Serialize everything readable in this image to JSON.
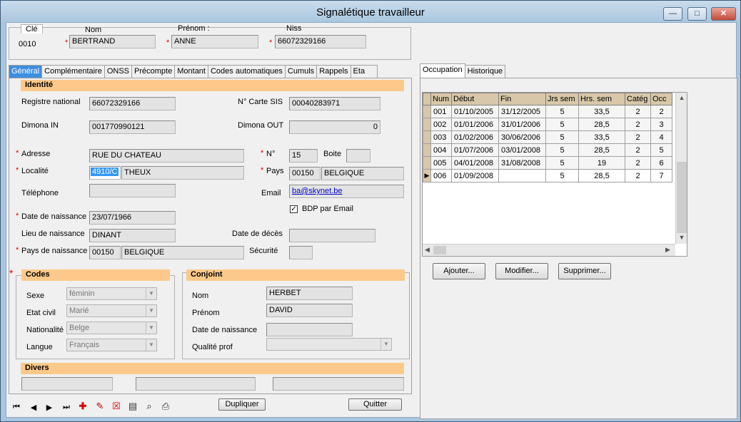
{
  "window": {
    "title": "Signalétique travailleur",
    "minimize": "—",
    "maximize": "□",
    "close": "✕"
  },
  "header": {
    "cle_label": "Clé",
    "cle_value": "0010",
    "nom_label": "Nom",
    "nom_value": "BERTRAND",
    "prenom_label": "Prénom :",
    "prenom_value": "ANNE",
    "niss_label": "Niss",
    "niss_value": "66072329166",
    "required_mark": "*"
  },
  "left_tabs": [
    "Général",
    "Complémentaire",
    "ONSS",
    "Précompte",
    "Montant",
    "Codes automatiques",
    "Cumuls",
    "Rappels",
    "Eta"
  ],
  "identite": {
    "title": "Identité",
    "registre_label": "Registre national",
    "registre_value": "66072329166",
    "carte_sis_label": "N° Carte SIS",
    "carte_sis_value": "00040283971",
    "dimona_in_label": "Dimona IN",
    "dimona_in_value": "001770990121",
    "dimona_out_label": "Dimona OUT",
    "dimona_out_value": "0",
    "adresse_label": "Adresse",
    "adresse_value": "RUE DU CHATEAU",
    "numero_label": "N°",
    "numero_value": "15",
    "boite_label": "Boite",
    "boite_value": "",
    "localite_label": "Localité",
    "localite_code": "4910/C",
    "localite_value": "THEUX",
    "pays_label": "Pays",
    "pays_code": "00150",
    "pays_value": "BELGIQUE",
    "telephone_label": "Téléphone",
    "telephone_value": "",
    "email_label": "Email",
    "email_value": "ba@skynet.be",
    "bdp_label": "BDP par Email",
    "bdp_checked": "✓",
    "naissance_label": "Date de naissance",
    "naissance_value": "23/07/1966",
    "lieu_label": "Lieu de naissance",
    "lieu_value": "DINANT",
    "deces_label": "Date de décès",
    "deces_value": "",
    "pays_naissance_label": "Pays de naissance",
    "pays_naissance_code": "00150",
    "pays_naissance_value": "BELGIQUE",
    "securite_label": "Sécurité",
    "securite_value": ""
  },
  "codes": {
    "title": "Codes",
    "sexe_label": "Sexe",
    "sexe_value": "féminin",
    "etat_civil_label": "Etat civil",
    "etat_civil_value": "Marié",
    "nationalite_label": "Nationalité",
    "nationalite_value": "Belge",
    "langue_label": "Langue",
    "langue_value": "Français"
  },
  "conjoint": {
    "title": "Conjoint",
    "nom_label": "Nom",
    "nom_value": "HERBET",
    "prenom_label": "Prénom",
    "prenom_value": "DAVID",
    "naissance_label": "Date de naissance",
    "naissance_value": "",
    "qualite_label": "Qualité prof",
    "qualite_value": ""
  },
  "divers": {
    "title": "Divers"
  },
  "bottom": {
    "dupliquer": "Dupliquer",
    "quitter": "Quitter",
    "nav": [
      "⏮",
      "◀",
      "▶",
      "⏭"
    ]
  },
  "right_tabs": [
    "Occupation",
    "Historique"
  ],
  "occupation": {
    "columns": [
      "Num",
      "Début",
      "Fin",
      "Jrs sem",
      "Hrs. sem",
      "Catég",
      "Occ"
    ],
    "rows": [
      [
        "001",
        "01/10/2005",
        "31/12/2005",
        "5",
        "33,5",
        "2",
        "2"
      ],
      [
        "002",
        "01/01/2006",
        "31/01/2006",
        "5",
        "28,5",
        "2",
        "3"
      ],
      [
        "003",
        "01/02/2006",
        "30/06/2006",
        "5",
        "33,5",
        "2",
        "4"
      ],
      [
        "004",
        "01/07/2006",
        "03/01/2008",
        "5",
        "28,5",
        "2",
        "5"
      ],
      [
        "005",
        "04/01/2008",
        "31/08/2008",
        "5",
        "19",
        "2",
        "6"
      ],
      [
        "006",
        "01/09/2008",
        "",
        "5",
        "28,5",
        "2",
        "7"
      ]
    ],
    "current_row_marker": "▶",
    "ajouter": "Ajouter...",
    "modifier": "Modifier...",
    "supprimer": "Supprimer..."
  }
}
